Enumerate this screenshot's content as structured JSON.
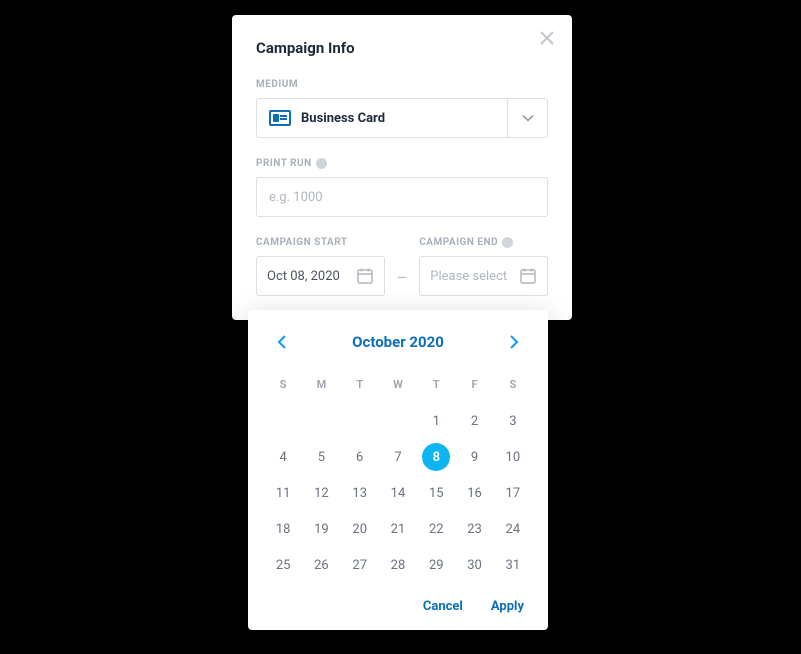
{
  "modal": {
    "title": "Campaign Info",
    "medium": {
      "label": "MEDIUM",
      "selected": "Business Card"
    },
    "print_run": {
      "label": "PRINT RUN",
      "placeholder": "e.g. 1000",
      "value": ""
    },
    "campaign_start": {
      "label": "CAMPAIGN START",
      "value": "Oct 08, 2020"
    },
    "campaign_end": {
      "label": "CAMPAIGN END",
      "placeholder": "Please select"
    }
  },
  "calendar": {
    "title": "October 2020",
    "day_headers": [
      "S",
      "M",
      "T",
      "W",
      "T",
      "F",
      "S"
    ],
    "leading_blanks": 4,
    "days": [
      1,
      2,
      3,
      4,
      5,
      6,
      7,
      8,
      9,
      10,
      11,
      12,
      13,
      14,
      15,
      16,
      17,
      18,
      19,
      20,
      21,
      22,
      23,
      24,
      25,
      26,
      27,
      28,
      29,
      30,
      31
    ],
    "selected_day": 8,
    "cancel_label": "Cancel",
    "apply_label": "Apply"
  }
}
